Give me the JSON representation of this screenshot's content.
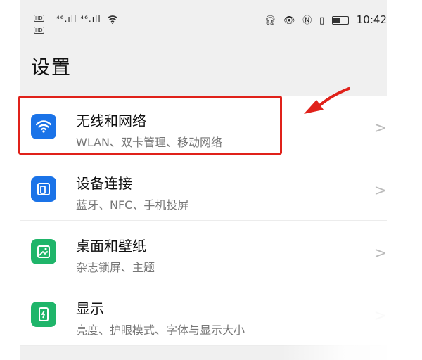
{
  "status_bar": {
    "hd1": "HD",
    "hd2": "HD",
    "signal": "⁴⁶.ıll ⁴⁶.ıll",
    "time": "10:42",
    "battery_level": 0.45
  },
  "page_title": "设置",
  "items": [
    {
      "title": "无线和网络",
      "subtitle": "WLAN、双卡管理、移动网络",
      "icon": "wifi-icon",
      "color": "#1a73e8"
    },
    {
      "title": "设备连接",
      "subtitle": "蓝牙、NFC、手机投屏",
      "icon": "device-connection-icon",
      "color": "#1a73e8"
    },
    {
      "title": "桌面和壁纸",
      "subtitle": "杂志锁屏、主题",
      "icon": "wallpaper-icon",
      "color": "#1fb56a"
    },
    {
      "title": "显示",
      "subtitle": "亮度、护眼模式、字体与显示大小",
      "icon": "display-icon",
      "color": "#1fb56a"
    }
  ],
  "colors": {
    "highlight": "#e0211a",
    "blue": "#1a73e8",
    "green": "#1fb56a"
  }
}
